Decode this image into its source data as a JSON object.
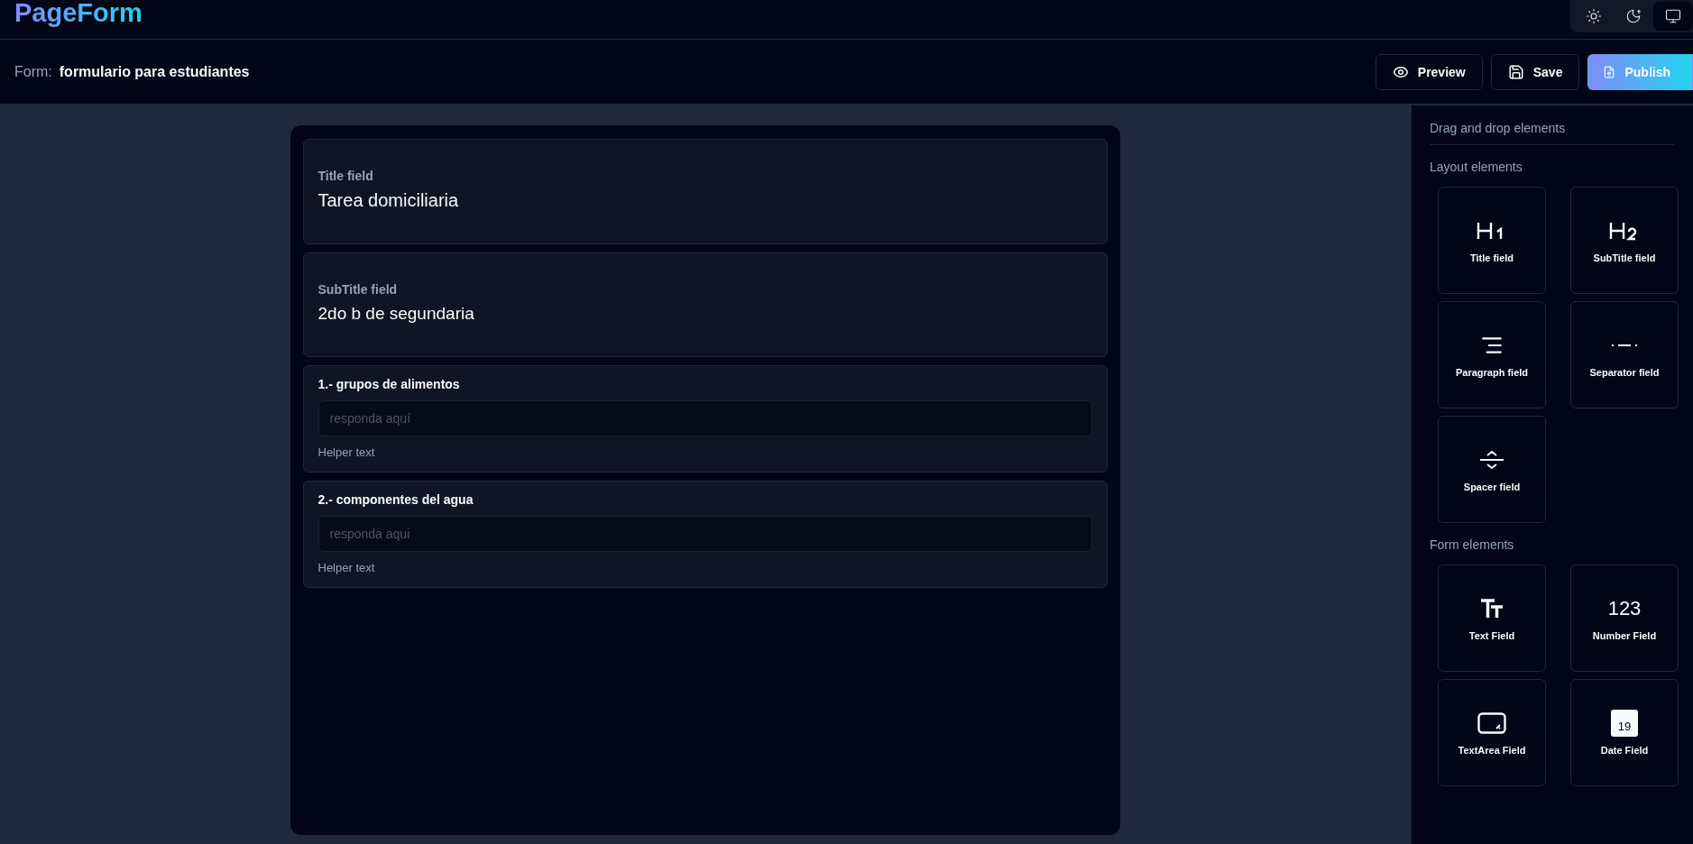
{
  "app": {
    "logo": "PageForm"
  },
  "theme_modes": [
    {
      "kind": "light",
      "selected": false
    },
    {
      "kind": "dark",
      "selected": false
    },
    {
      "kind": "system",
      "selected": true
    }
  ],
  "header": {
    "form_label": "Form:",
    "form_name": "formulario para estudiantes",
    "buttons": [
      {
        "kind": "preview",
        "label": "Preview"
      },
      {
        "kind": "save",
        "label": "Save"
      },
      {
        "kind": "publish",
        "label": "Publish"
      }
    ]
  },
  "form_fields": [
    {
      "kind": "title",
      "label": "Title field",
      "value": "Tarea domiciliaria"
    },
    {
      "kind": "subtitle",
      "label": "SubTitle field",
      "value": "2do b de segundaria"
    },
    {
      "kind": "text",
      "label": "1.- grupos de alimentos",
      "placeholder": "responda aquí",
      "helper": "Helper text"
    },
    {
      "kind": "text",
      "label": "2.- componentes del agua",
      "placeholder": "responda aqui",
      "helper": "Helper text"
    }
  ],
  "sidebar": {
    "title": "Drag and drop elements",
    "sections": [
      {
        "title": "Layout elements",
        "items": [
          {
            "kind": "h1",
            "label": "Title field"
          },
          {
            "kind": "h2",
            "label": "SubTitle field"
          },
          {
            "kind": "paragraph",
            "label": "Paragraph field"
          },
          {
            "kind": "separator",
            "label": "Separator field"
          },
          {
            "kind": "spacer",
            "label": "Spacer field"
          }
        ]
      },
      {
        "title": "Form elements",
        "items": [
          {
            "kind": "text",
            "label": "Text Field"
          },
          {
            "kind": "number",
            "label": "Number Field",
            "glyph": "123"
          },
          {
            "kind": "textarea",
            "label": "TextArea Field"
          },
          {
            "kind": "date",
            "label": "Date Field",
            "glyph": "19"
          }
        ]
      }
    ]
  }
}
